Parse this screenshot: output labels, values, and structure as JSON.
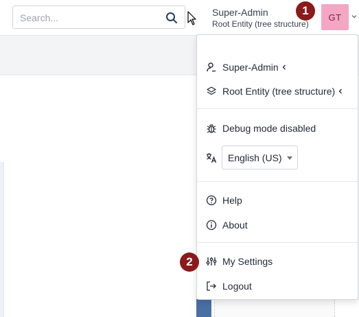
{
  "search": {
    "placeholder": "Search..."
  },
  "user": {
    "name": "Super-Admin",
    "entity": "Root Entity (tree structure)",
    "initials": "GT",
    "avatar_color": "#f4a7c3"
  },
  "badges": {
    "first": "1",
    "second": "2",
    "color": "#8b1a1a"
  },
  "menu": {
    "profile_label": "Super-Admin",
    "entity_label": "Root Entity (tree structure)",
    "debug_label": "Debug mode disabled",
    "language_value": "English (US)",
    "help_label": "Help",
    "about_label": "About",
    "settings_label": "My Settings",
    "logout_label": "Logout"
  },
  "icons": {
    "search": "search-icon",
    "profile": "user-icon",
    "entity": "layers-icon",
    "debug": "bug-icon",
    "language": "translate-icon",
    "help": "help-circle-icon",
    "about": "info-circle-icon",
    "settings": "sliders-icon",
    "logout": "logout-icon"
  }
}
